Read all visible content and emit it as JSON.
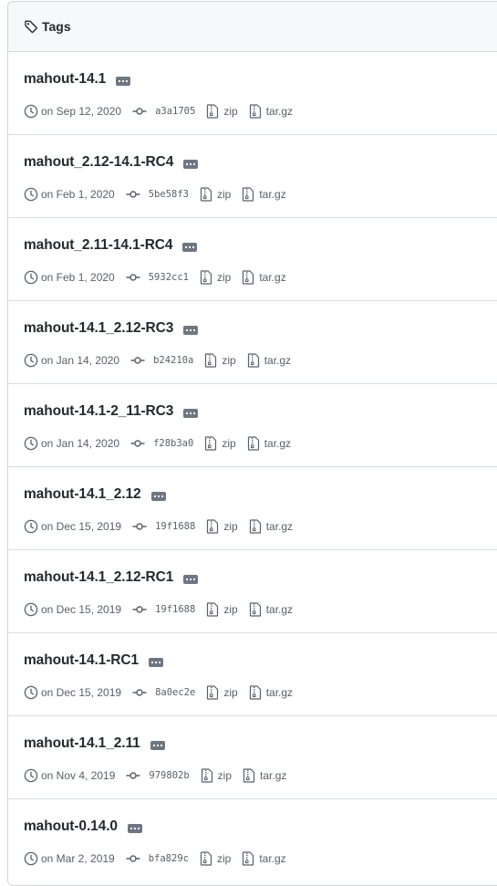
{
  "header": {
    "title": "Tags"
  },
  "tags": [
    {
      "name": "mahout-14.1",
      "date": "on Sep 12, 2020",
      "sha": "a3a1705",
      "zip": "zip",
      "targz": "tar.gz"
    },
    {
      "name": "mahout_2.12-14.1-RC4",
      "date": "on Feb 1, 2020",
      "sha": "5be58f3",
      "zip": "zip",
      "targz": "tar.gz"
    },
    {
      "name": "mahout_2.11-14.1-RC4",
      "date": "on Feb 1, 2020",
      "sha": "5932cc1",
      "zip": "zip",
      "targz": "tar.gz"
    },
    {
      "name": "mahout-14.1_2.12-RC3",
      "date": "on Jan 14, 2020",
      "sha": "b24210a",
      "zip": "zip",
      "targz": "tar.gz"
    },
    {
      "name": "mahout-14.1-2_11-RC3",
      "date": "on Jan 14, 2020",
      "sha": "f28b3a0",
      "zip": "zip",
      "targz": "tar.gz"
    },
    {
      "name": "mahout-14.1_2.12",
      "date": "on Dec 15, 2019",
      "sha": "19f1688",
      "zip": "zip",
      "targz": "tar.gz"
    },
    {
      "name": "mahout-14.1_2.12-RC1",
      "date": "on Dec 15, 2019",
      "sha": "19f1688",
      "zip": "zip",
      "targz": "tar.gz"
    },
    {
      "name": "mahout-14.1-RC1",
      "date": "on Dec 15, 2019",
      "sha": "8a0ec2e",
      "zip": "zip",
      "targz": "tar.gz"
    },
    {
      "name": "mahout-14.1_2.11",
      "date": "on Nov 4, 2019",
      "sha": "979802b",
      "zip": "zip",
      "targz": "tar.gz"
    },
    {
      "name": "mahout-0.14.0",
      "date": "on Mar 2, 2019",
      "sha": "bfa829c",
      "zip": "zip",
      "targz": "tar.gz"
    }
  ],
  "colors": {
    "text": "#24292f",
    "muted": "#57606a",
    "border": "#d0d7de",
    "header_bg": "#f6f8fa",
    "ellipsis_bg": "#6e7781"
  }
}
